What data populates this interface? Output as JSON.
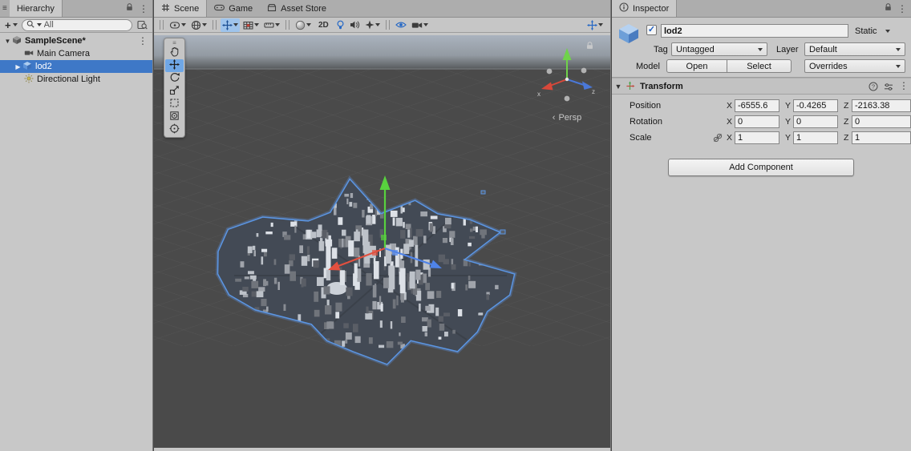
{
  "icons": {
    "plus": "+",
    "kebab": "⋮",
    "menu": "≡",
    "foldout_open": "▼",
    "foldout_closed": "▶",
    "check": "✓",
    "help": "?",
    "chevron": "‹"
  },
  "hierarchy": {
    "tab": "Hierarchy",
    "search_placeholder": "All",
    "scene_name": "SampleScene*",
    "items": [
      {
        "label": "Main Camera"
      },
      {
        "label": "lod2"
      },
      {
        "label": "Directional Light"
      }
    ]
  },
  "scene_view": {
    "tabs": [
      {
        "label": "Scene"
      },
      {
        "label": "Game"
      },
      {
        "label": "Asset Store"
      }
    ],
    "toolbar": {
      "two_d": "2D"
    },
    "gizmo": {
      "persp": "Persp",
      "axis_x": "x",
      "axis_z": "z"
    }
  },
  "inspector": {
    "tab": "Inspector",
    "name": "lod2",
    "static_label": "Static",
    "tag_label": "Tag",
    "tag_value": "Untagged",
    "layer_label": "Layer",
    "layer_value": "Default",
    "model_label": "Model",
    "open_label": "Open",
    "select_label": "Select",
    "overrides_label": "Overrides",
    "transform": {
      "title": "Transform",
      "axis": {
        "x": "X",
        "y": "Y",
        "z": "Z"
      },
      "position": {
        "label": "Position",
        "x": "-6555.6",
        "y": "-0.4265",
        "z": "-2163.38"
      },
      "rotation": {
        "label": "Rotation",
        "x": "0",
        "y": "0",
        "z": "0"
      },
      "scale": {
        "label": "Scale",
        "x": "1",
        "y": "1",
        "z": "1"
      }
    },
    "add_component": "Add Component"
  }
}
